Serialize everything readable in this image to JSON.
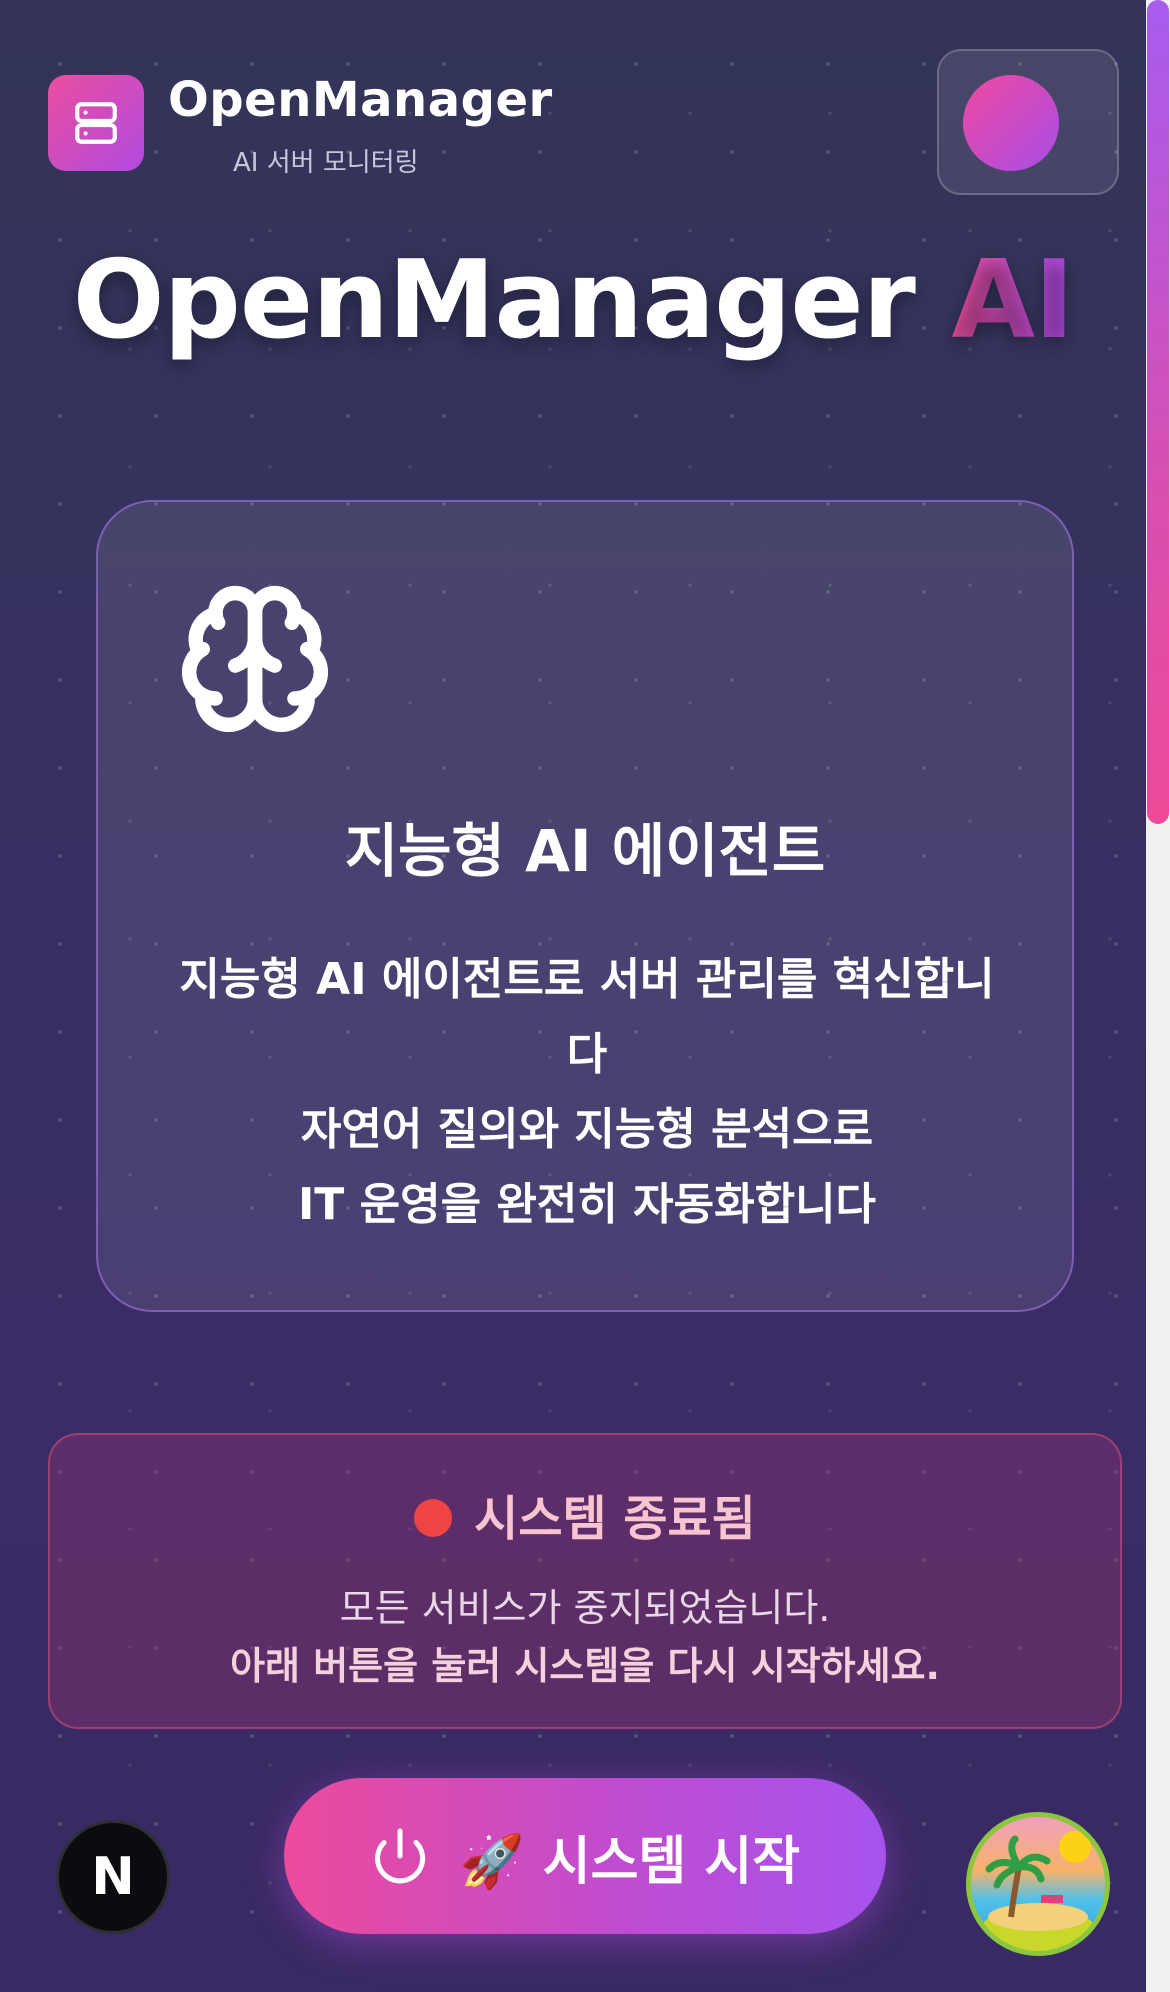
{
  "header": {
    "brand_title": "OpenManager",
    "brand_subtitle": "AI 서버 모니터링",
    "logo_icon": "server-icon",
    "profile_icon": "avatar"
  },
  "hero": {
    "title_main": "OpenManager ",
    "title_accent": "AI"
  },
  "feature_card": {
    "icon": "brain-icon",
    "title": "지능형 AI 에이전트",
    "description_lines": [
      "지능형 AI 에이전트로 서버 관리를 혁신합니다",
      "자연어 질의와 지능형 분석으로",
      "IT 운영을 완전히 자동화합니다"
    ]
  },
  "status": {
    "title": "시스템 종료됨",
    "message": "모든 서비스가 중지되었습니다.",
    "instruction": "아래 버튼을 눌러 시스템을 다시 시작하세요.",
    "indicator_color": "#ef4444"
  },
  "actions": {
    "start_label": "🚀 시스템 시작",
    "start_icon": "power-icon"
  },
  "footer": {
    "framework_badge": "N",
    "mascot_icon": "island-icon"
  },
  "colors": {
    "accent_pink": "#ec4e9e",
    "accent_purple": "#a84ce6",
    "background": "#35305f"
  }
}
